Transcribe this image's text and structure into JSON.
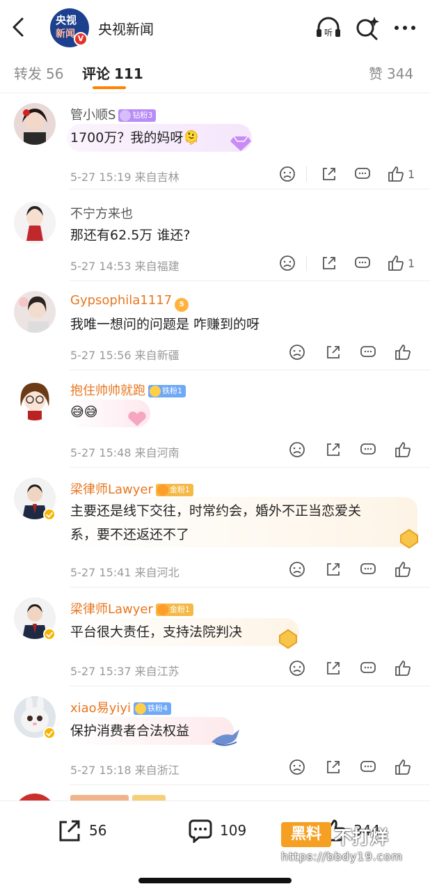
{
  "header": {
    "back_icon": "back-arrow-icon",
    "avatar_line1": "央视",
    "avatar_line2": "新闻",
    "verified_mark": "V",
    "account_name": "央视新闻",
    "listen_label": "听",
    "icons": [
      "listen-icon",
      "search-sparkle-icon",
      "more-icon"
    ]
  },
  "tabs": [
    {
      "label": "转发",
      "count": "56"
    },
    {
      "label": "评论",
      "count": "111"
    },
    {
      "label": "赞",
      "count": "344"
    }
  ],
  "comments": [
    {
      "name": "管小顺S",
      "badge": "钻粉3",
      "text": "1700万？我的妈呀",
      "emoji": "🫠",
      "time": "5-27 15:19",
      "location": "来自吉林",
      "likes": "1"
    },
    {
      "name": "不宁方来也",
      "text": "那还有62.5万 谁还?",
      "time": "5-27 14:53",
      "location": "来自福建",
      "likes": "1"
    },
    {
      "name": "Gypsophila1117",
      "level": "5",
      "text": "我唯一想问的问题是 咋赚到的呀",
      "time": "5-27 15:56",
      "location": "来自新疆",
      "likes": ""
    },
    {
      "name": "抱住帅帅就跑",
      "badge": "铁粉1",
      "text": "😅😅",
      "time": "5-27 15:48",
      "location": "来自河南",
      "likes": ""
    },
    {
      "name": "梁律师Lawyer",
      "badge": "金粉1",
      "text_line1": "主要还是线下交往，时常约会，婚外不正当恋爱关",
      "text_line2": "系，要不还返还不了",
      "time": "5-27 15:41",
      "location": "来自河北",
      "likes": ""
    },
    {
      "name": "梁律师Lawyer",
      "badge": "金粉1",
      "text": "平台很大责任，支持法院判决",
      "time": "5-27 15:37",
      "location": "来自江苏",
      "likes": ""
    },
    {
      "name": "xiao易yiyi",
      "badge": "铁粉4",
      "text": "保护消费者合法权益",
      "time": "5-27 15:18",
      "location": "来自浙江",
      "likes": ""
    }
  ],
  "bottom_bar": {
    "share_count": "56",
    "comment_count": "109",
    "like_count": "344"
  },
  "watermark": {
    "box_text": "黑料",
    "text": "不打烊",
    "url": "https://bbdy19.com"
  },
  "colors": {
    "accent": "#ff8200",
    "vip_name": "#e8761f",
    "meta": "#999999"
  }
}
